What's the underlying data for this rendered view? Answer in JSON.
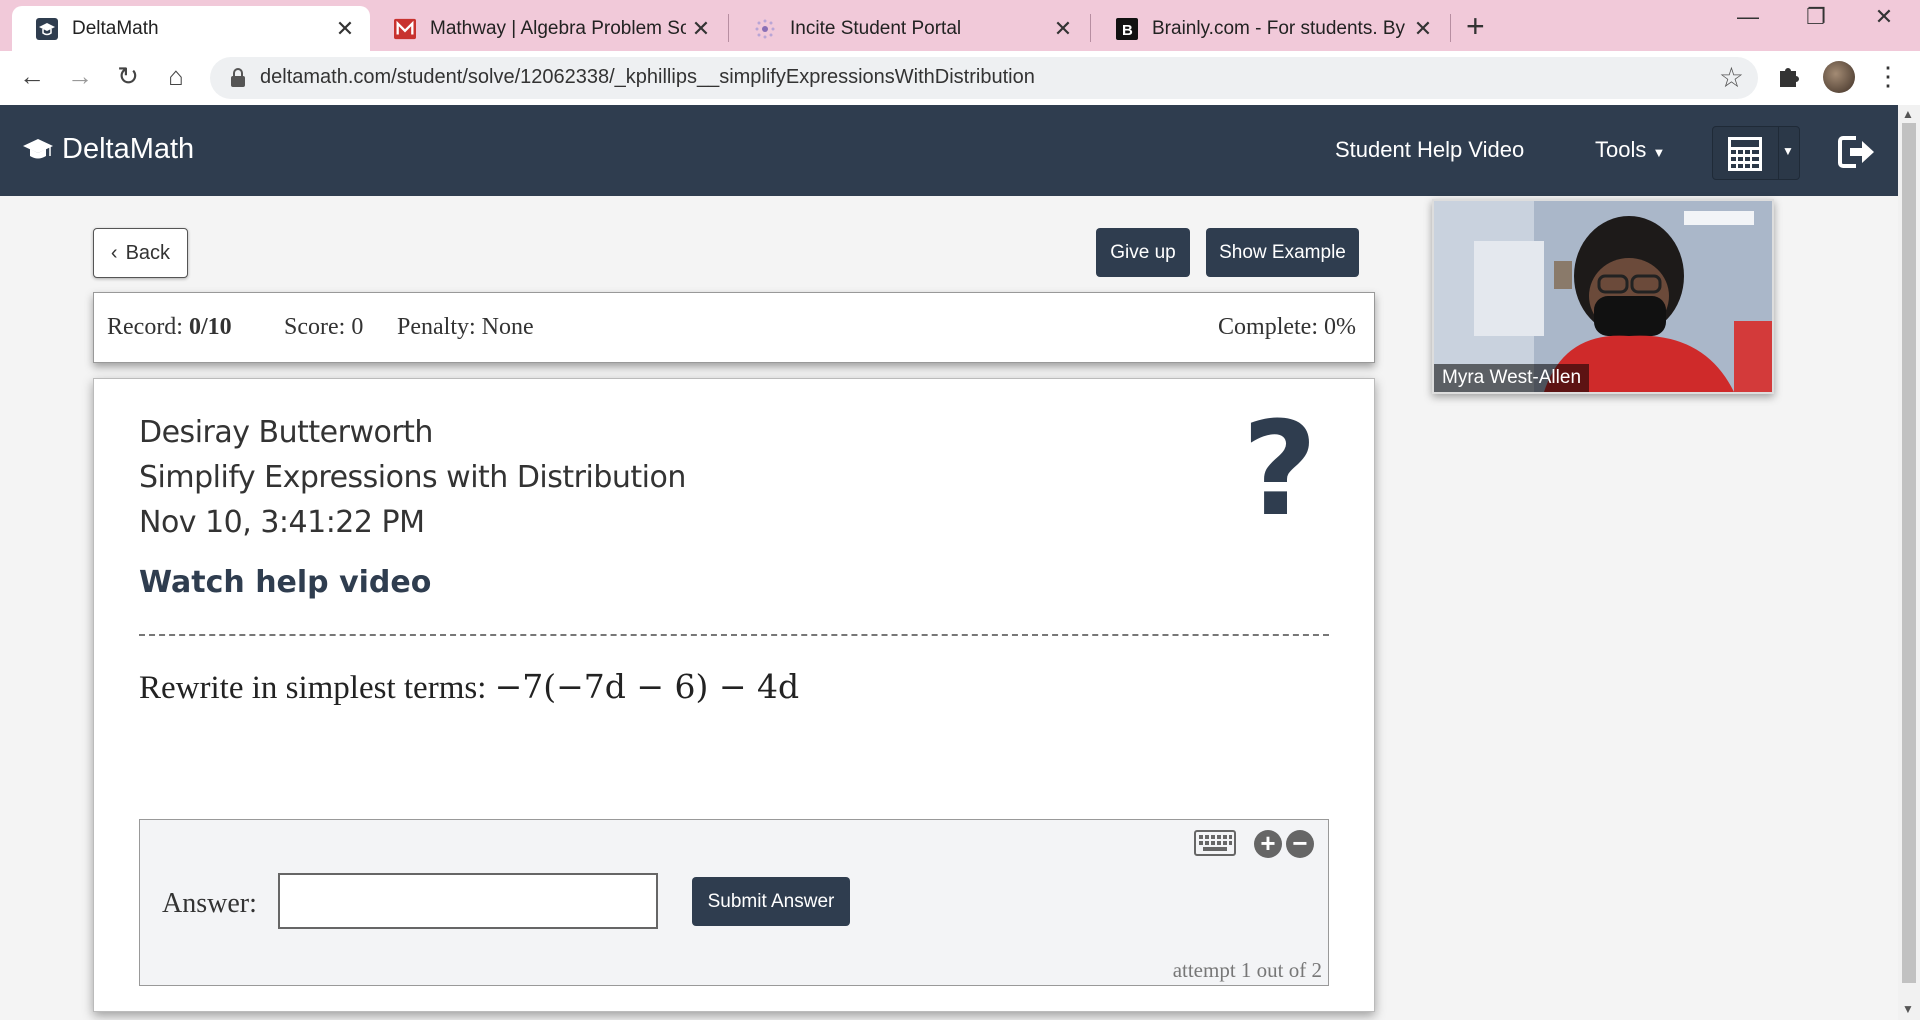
{
  "browser": {
    "tabs": [
      {
        "title": "DeltaMath",
        "active": true
      },
      {
        "title": "Mathway | Algebra Problem Solv",
        "active": false
      },
      {
        "title": "Incite Student Portal",
        "active": false
      },
      {
        "title": "Brainly.com - For students. By stu",
        "active": false
      }
    ],
    "url": "deltamath.com/student/solve/12062338/_kphillips__simplifyExpressionsWithDistribution"
  },
  "header": {
    "logo": "DeltaMath",
    "help_video": "Student Help Video",
    "tools": "Tools"
  },
  "actions": {
    "back": "Back",
    "give_up": "Give up",
    "show_example": "Show Example"
  },
  "record": {
    "record_label": "Record:",
    "record_value": "0/10",
    "score": "Score: 0",
    "penalty": "Penalty: None",
    "complete": "Complete: 0%"
  },
  "problem": {
    "student_name": "Desiray Butterworth",
    "assignment": "Simplify Expressions with Distribution",
    "timestamp": "Nov 10, 3:41:22 PM",
    "help_link": "Watch help video",
    "prompt_text": "Rewrite in simplest terms:",
    "expression": "−7(−7d − 6) − 4d"
  },
  "answer": {
    "label": "Answer:",
    "value": "",
    "submit": "Submit Answer",
    "attempt": "attempt 1 out of 2"
  },
  "video": {
    "participant": "Myra West-Allen"
  },
  "colors": {
    "header_bg": "#2f3d4f",
    "tabbar_bg": "#f1c9d9"
  }
}
